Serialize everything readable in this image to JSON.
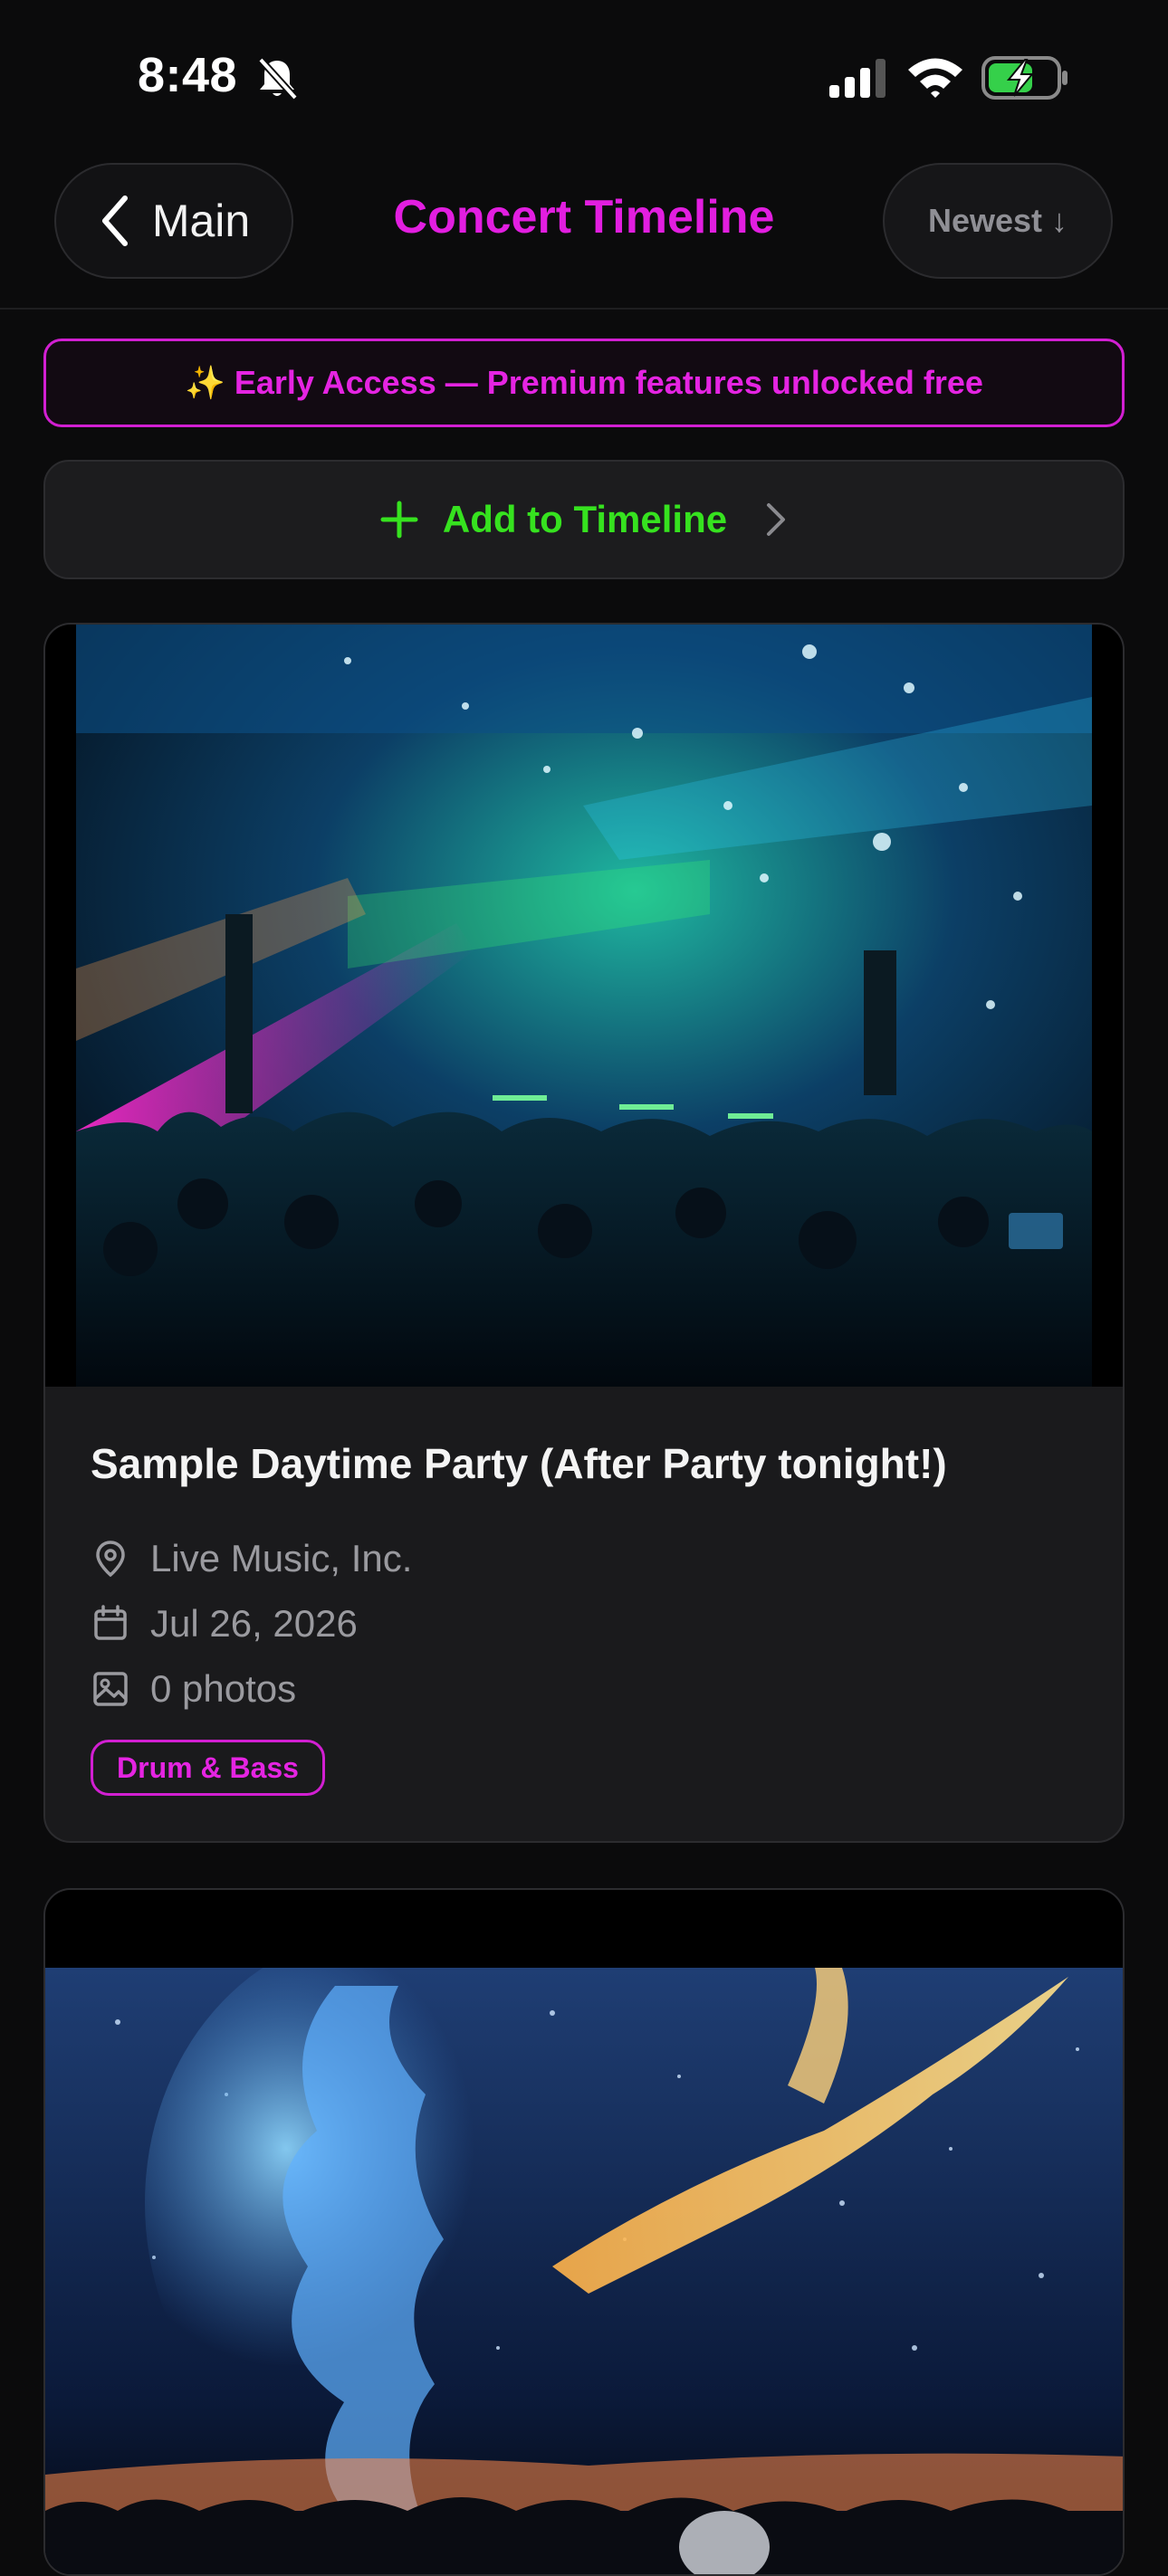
{
  "status_bar": {
    "time": "8:48"
  },
  "header": {
    "back_label": "Main",
    "title": "Concert Timeline",
    "sort_label": "Newest ↓"
  },
  "banner": {
    "text": "✨ Early Access — Premium features unlocked free"
  },
  "add_button": {
    "label": "Add to Timeline"
  },
  "events": [
    {
      "title": "Sample Daytime Party (After Party tonight!)",
      "venue": "Live Music, Inc.",
      "date": "Jul 26, 2026",
      "photos": "0 photos",
      "tag": "Drum & Bass"
    }
  ],
  "colors": {
    "accent_magenta": "#e21ee0",
    "accent_green": "#36e21f",
    "background": "#0b0b0c",
    "card": "#1a1a1c"
  }
}
